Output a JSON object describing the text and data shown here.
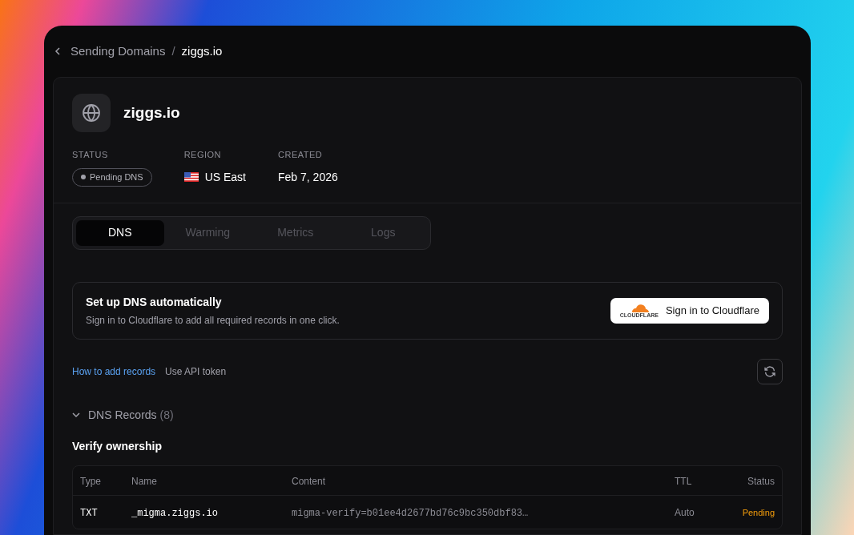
{
  "breadcrumb": {
    "parent": "Sending Domains",
    "separator": "/",
    "current": "ziggs.io"
  },
  "domain": {
    "name": "ziggs.io"
  },
  "meta": [
    {
      "kind": "status",
      "label": "STATUS",
      "value": "Pending DNS"
    },
    {
      "kind": "region",
      "label": "REGION",
      "value": "US East"
    },
    {
      "kind": "text",
      "label": "CREATED",
      "value": "Feb 7, 2026"
    }
  ],
  "tabs": [
    {
      "label": "DNS",
      "selected": true
    },
    {
      "label": "Warming",
      "selected": false
    },
    {
      "label": "Metrics",
      "selected": false
    },
    {
      "label": "Logs",
      "selected": false
    }
  ],
  "setup": {
    "title": "Set up DNS automatically",
    "description": "Sign in to Cloudflare to add all required records in one click.",
    "button": "Sign in to Cloudflare",
    "logo_text": "CLOUDFLARE"
  },
  "links": [
    {
      "label": "How to add records",
      "kind": "link"
    },
    {
      "label": "Use API token",
      "kind": "plain"
    }
  ],
  "records": {
    "title": "DNS Records",
    "count": "(8)",
    "expanded": true,
    "group": "Verify ownership",
    "columns": [
      "Type",
      "Name",
      "Content",
      "TTL",
      "Status"
    ],
    "rows": [
      {
        "type": "TXT",
        "name": "_migma.ziggs.io",
        "content": "migma-verify=b01ee4d2677bd76c9bc350dbf83…",
        "ttl": "Auto",
        "status": "Pending"
      }
    ]
  }
}
